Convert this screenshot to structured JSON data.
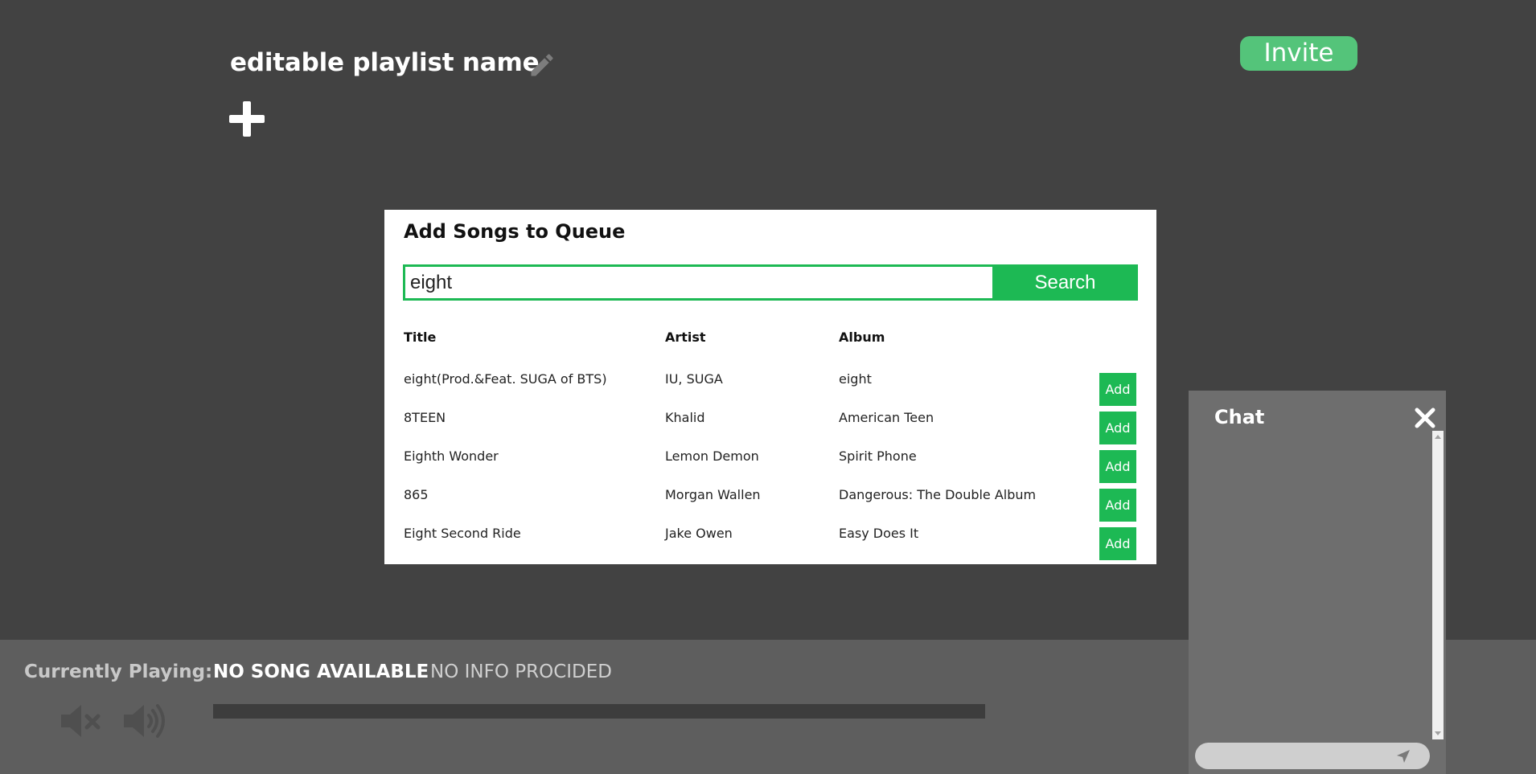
{
  "header": {
    "playlist_name": "editable playlist name",
    "invite_label": "Invite",
    "edit_icon": "pencil-icon",
    "add_icon": "plus-icon"
  },
  "modal": {
    "title": "Add Songs to Queue",
    "search": {
      "value": "eight",
      "button_label": "Search"
    },
    "columns": {
      "title": "Title",
      "artist": "Artist",
      "album": "Album"
    },
    "add_label": "Add",
    "results": [
      {
        "title": "eight(Prod.&Feat. SUGA of BTS)",
        "artist": "IU, SUGA",
        "album": "eight"
      },
      {
        "title": "8TEEN",
        "artist": "Khalid",
        "album": "American Teen"
      },
      {
        "title": "Eighth Wonder",
        "artist": "Lemon Demon",
        "album": "Spirit Phone"
      },
      {
        "title": "865",
        "artist": "Morgan Wallen",
        "album": "Dangerous: The Double Album"
      },
      {
        "title": "Eight Second Ride",
        "artist": "Jake Owen",
        "album": "Easy Does It"
      }
    ]
  },
  "player": {
    "label": "Currently Playing:",
    "song": "NO SONG AVAILABLE",
    "info": "NO INFO PROCIDED",
    "progress": 0,
    "mute_icon": "volume-mute-icon",
    "volume_icon": "volume-up-icon"
  },
  "chat": {
    "title": "Chat",
    "input_value": "",
    "close_icon": "close-icon",
    "send_icon": "send-icon"
  },
  "colors": {
    "background": "#424242",
    "accent_green": "#1db954",
    "invite_green": "#54c47a",
    "player_bg": "#5e5e5e",
    "chat_bg": "#6e6e6e"
  }
}
